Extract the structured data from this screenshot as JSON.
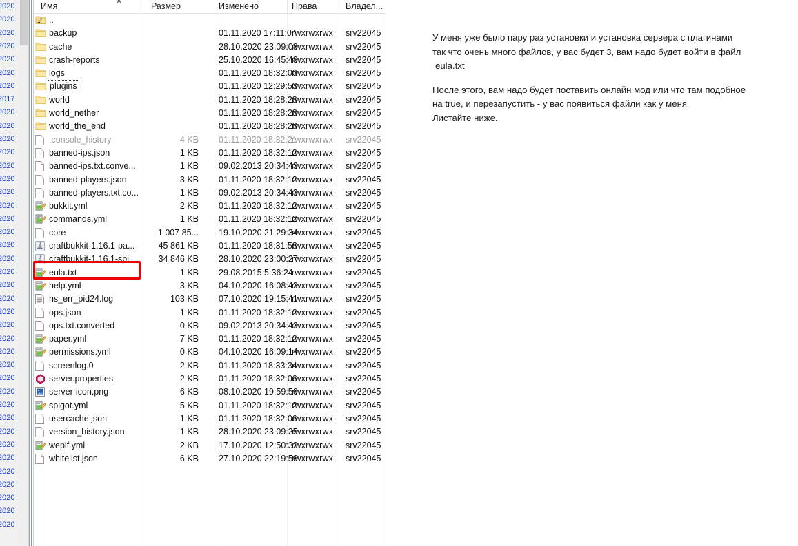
{
  "window": {
    "close_icon": "close-x-icon"
  },
  "columns": {
    "name": "Имя",
    "size": "Размер",
    "modified": "Изменено",
    "rights": "Права",
    "owner": "Владел..."
  },
  "left_strip": {
    "note": "clipped neighbouring panel showing partial blue dates",
    "color": "#1a3fd4",
    "entries": [
      ".2020",
      ".2020",
      ".2020",
      ".2020",
      ".2020",
      ".2020",
      ".2020",
      ".2017",
      ".2020",
      ".2020",
      ".2020",
      ".2020",
      ".2020",
      ".2020",
      ".2020",
      ".2020",
      ".2020",
      ".2020",
      ".2020",
      ".2020",
      ".2020",
      ".2020",
      ".2020",
      ".2020",
      ".2020",
      ".2020",
      ".2020",
      ".2020",
      ".2020",
      ".2020",
      ".2020",
      ".2020",
      ".2020",
      ".2020",
      ".2020",
      ".2020",
      ".2020",
      ".2020",
      ".2020",
      ".2020"
    ]
  },
  "files": [
    {
      "icon": "folder-up-icon",
      "name": "..",
      "size": "",
      "modified": "",
      "rights": "",
      "owner": "",
      "dim": false,
      "focus": false
    },
    {
      "icon": "folder-icon",
      "name": "backup",
      "size": "",
      "modified": "01.11.2020 17:11:04",
      "rights": "rwxrwxrwx",
      "owner": "srv22045",
      "dim": false,
      "focus": false
    },
    {
      "icon": "folder-icon",
      "name": "cache",
      "size": "",
      "modified": "28.10.2020 23:09:08",
      "rights": "rwxrwxrwx",
      "owner": "srv22045",
      "dim": false,
      "focus": false
    },
    {
      "icon": "folder-icon",
      "name": "crash-reports",
      "size": "",
      "modified": "25.10.2020 16:45:48",
      "rights": "rwxrwxrwx",
      "owner": "srv22045",
      "dim": false,
      "focus": false
    },
    {
      "icon": "folder-icon",
      "name": "logs",
      "size": "",
      "modified": "01.11.2020 18:32:00",
      "rights": "rwxrwxrwx",
      "owner": "srv22045",
      "dim": false,
      "focus": false
    },
    {
      "icon": "folder-icon",
      "name": "plugins",
      "size": "",
      "modified": "01.11.2020 12:29:53",
      "rights": "rwxrwxrwx",
      "owner": "srv22045",
      "dim": false,
      "focus": true
    },
    {
      "icon": "folder-icon",
      "name": "world",
      "size": "",
      "modified": "01.11.2020 18:28:28",
      "rights": "rwxrwxrwx",
      "owner": "srv22045",
      "dim": false,
      "focus": false
    },
    {
      "icon": "folder-icon",
      "name": "world_nether",
      "size": "",
      "modified": "01.11.2020 18:28:28",
      "rights": "rwxrwxrwx",
      "owner": "srv22045",
      "dim": false,
      "focus": false
    },
    {
      "icon": "folder-icon",
      "name": "world_the_end",
      "size": "",
      "modified": "01.11.2020 18:28:28",
      "rights": "rwxrwxrwx",
      "owner": "srv22045",
      "dim": false,
      "focus": false
    },
    {
      "icon": "file-blank-icon",
      "name": ".console_history",
      "size": "4 KB",
      "modified": "01.11.2020 18:32:21",
      "rights": "rwxrwxrwx",
      "owner": "srv22045",
      "dim": true,
      "focus": false
    },
    {
      "icon": "file-blank-icon",
      "name": "banned-ips.json",
      "size": "1 KB",
      "modified": "01.11.2020 18:32:12",
      "rights": "rwxrwxrwx",
      "owner": "srv22045",
      "dim": false,
      "focus": false
    },
    {
      "icon": "file-blank-icon",
      "name": "banned-ips.txt.conve...",
      "size": "1 KB",
      "modified": "09.02.2013 20:34:43",
      "rights": "rwxrwxrwx",
      "owner": "srv22045",
      "dim": false,
      "focus": false
    },
    {
      "icon": "file-blank-icon",
      "name": "banned-players.json",
      "size": "3 KB",
      "modified": "01.11.2020 18:32:12",
      "rights": "rwxrwxrwx",
      "owner": "srv22045",
      "dim": false,
      "focus": false
    },
    {
      "icon": "file-blank-icon",
      "name": "banned-players.txt.co...",
      "size": "1 KB",
      "modified": "09.02.2013 20:34:43",
      "rights": "rwxrwxrwx",
      "owner": "srv22045",
      "dim": false,
      "focus": false
    },
    {
      "icon": "notepad-icon",
      "name": "bukkit.yml",
      "size": "2 KB",
      "modified": "01.11.2020 18:32:12",
      "rights": "rwxrwxrwx",
      "owner": "srv22045",
      "dim": false,
      "focus": false
    },
    {
      "icon": "notepad-icon",
      "name": "commands.yml",
      "size": "1 KB",
      "modified": "01.11.2020 18:32:12",
      "rights": "rwxrwxrwx",
      "owner": "srv22045",
      "dim": false,
      "focus": false
    },
    {
      "icon": "file-blank-icon",
      "name": "core",
      "size": "1 007 85...",
      "modified": "19.10.2020 21:29:34",
      "rights": "rwxrwxrwx",
      "owner": "srv22045",
      "dim": false,
      "focus": false
    },
    {
      "icon": "java-jar-icon",
      "name": "craftbukkit-1.16.1-pa...",
      "size": "45 861 KB",
      "modified": "01.11.2020 18:31:58",
      "rights": "rwxrwxrwx",
      "owner": "srv22045",
      "dim": false,
      "focus": false
    },
    {
      "icon": "java-jar-icon",
      "name": "craftbukkit-1.16.1-spi",
      "size": "34 846 KB",
      "modified": "28.10.2020 23:00:27",
      "rights": "rwxrwxrwx",
      "owner": "srv22045",
      "dim": false,
      "focus": false
    },
    {
      "icon": "notepad-icon",
      "name": "eula.txt",
      "size": "1 KB",
      "modified": "29.08.2015 5:36:24",
      "rights": "rwxrwxrwx",
      "owner": "srv22045",
      "dim": false,
      "focus": false
    },
    {
      "icon": "notepad-icon",
      "name": "help.yml",
      "size": "3 KB",
      "modified": "04.10.2020 16:08:42",
      "rights": "rwxrwxrwx",
      "owner": "srv22045",
      "dim": false,
      "focus": false
    },
    {
      "icon": "log-lines-icon",
      "name": "hs_err_pid24.log",
      "size": "103 KB",
      "modified": "07.10.2020 19:15:41",
      "rights": "rwxrwxrwx",
      "owner": "srv22045",
      "dim": false,
      "focus": false
    },
    {
      "icon": "file-blank-icon",
      "name": "ops.json",
      "size": "1 KB",
      "modified": "01.11.2020 18:32:12",
      "rights": "rwxrwxrwx",
      "owner": "srv22045",
      "dim": false,
      "focus": false
    },
    {
      "icon": "file-blank-icon",
      "name": "ops.txt.converted",
      "size": "0 KB",
      "modified": "09.02.2013 20:34:43",
      "rights": "rwxrwxrwx",
      "owner": "srv22045",
      "dim": false,
      "focus": false
    },
    {
      "icon": "notepad-icon",
      "name": "paper.yml",
      "size": "7 KB",
      "modified": "01.11.2020 18:32:12",
      "rights": "rwxrwxrwx",
      "owner": "srv22045",
      "dim": false,
      "focus": false
    },
    {
      "icon": "notepad-icon",
      "name": "permissions.yml",
      "size": "0 KB",
      "modified": "04.10.2020 16:09:14",
      "rights": "rwxrwxrwx",
      "owner": "srv22045",
      "dim": false,
      "focus": false
    },
    {
      "icon": "file-blank-icon",
      "name": "screenlog.0",
      "size": "2 KB",
      "modified": "01.11.2020 18:33:34",
      "rights": "rwxrwxrwx",
      "owner": "srv22045",
      "dim": false,
      "focus": false
    },
    {
      "icon": "properties-hex-icon",
      "name": "server.properties",
      "size": "2 KB",
      "modified": "01.11.2020 18:32:06",
      "rights": "rwxrwxrwx",
      "owner": "srv22045",
      "dim": false,
      "focus": false
    },
    {
      "icon": "image-png-icon",
      "name": "server-icon.png",
      "size": "6 KB",
      "modified": "08.10.2020 19:59:56",
      "rights": "rwxrwxrwx",
      "owner": "srv22045",
      "dim": false,
      "focus": false
    },
    {
      "icon": "notepad-icon",
      "name": "spigot.yml",
      "size": "5 KB",
      "modified": "01.11.2020 18:32:12",
      "rights": "rwxrwxrwx",
      "owner": "srv22045",
      "dim": false,
      "focus": false
    },
    {
      "icon": "file-blank-icon",
      "name": "usercache.json",
      "size": "1 KB",
      "modified": "01.11.2020 18:32:06",
      "rights": "rwxrwxrwx",
      "owner": "srv22045",
      "dim": false,
      "focus": false
    },
    {
      "icon": "file-blank-icon",
      "name": "version_history.json",
      "size": "1 KB",
      "modified": "28.10.2020 23:09:25",
      "rights": "rwxrwxrwx",
      "owner": "srv22045",
      "dim": false,
      "focus": false
    },
    {
      "icon": "notepad-icon",
      "name": "wepif.yml",
      "size": "2 KB",
      "modified": "17.10.2020 12:50:32",
      "rights": "rwxrwxrwx",
      "owner": "srv22045",
      "dim": false,
      "focus": false
    },
    {
      "icon": "file-blank-icon",
      "name": "whitelist.json",
      "size": "6 KB",
      "modified": "27.10.2020 22:19:56",
      "rights": "rwxrwxrwx",
      "owner": "srv22045",
      "dim": false,
      "focus": false
    }
  ],
  "annotation": {
    "highlight_color": "#ee0000",
    "highlight_target": "eula.txt"
  },
  "notes": {
    "paragraph1_line1": "У меня уже было пару раз установки и установка сервера с плагинами",
    "paragraph1_line2": "так что очень много файлов, у вас будет 3, вам надо будет войти в файл",
    "paragraph1_line3": "eula.txt",
    "paragraph2_line1": "После этого, вам надо будет поставить онлайн мод или что там подобное",
    "paragraph2_line2": "на true, и перезапустить - у вас появиться файли как у меня",
    "paragraph2_line3": "Листайте ниже."
  }
}
